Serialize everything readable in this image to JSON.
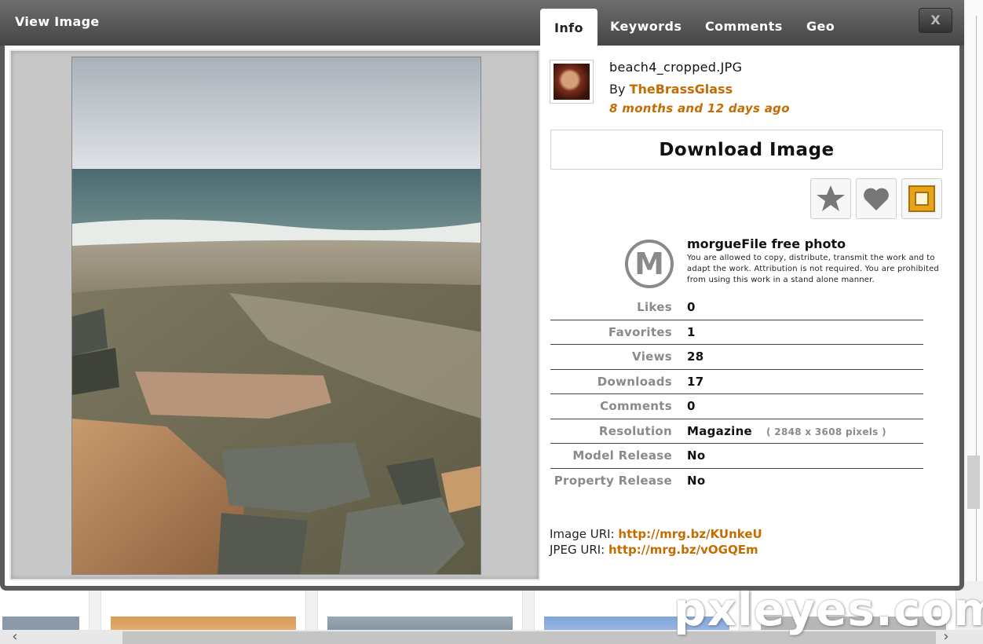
{
  "modal": {
    "title": "View Image",
    "tabs": [
      "Info",
      "Keywords",
      "Comments",
      "Geo"
    ],
    "close_label": "X"
  },
  "image": {
    "file_name": "beach4_cropped.JPG",
    "by_prefix": "By",
    "author": "TheBrassGlass",
    "age": "8 months and 12 days ago"
  },
  "download_label": "Download Image",
  "actions": [
    {
      "icon": "star-icon",
      "color": "#777777"
    },
    {
      "icon": "heart-icon",
      "color": "#777777"
    },
    {
      "icon": "frame-icon",
      "color": "#e8a31c"
    }
  ],
  "license": {
    "logo_letter": "M",
    "title": "morgueFile free photo",
    "text": "You are allowed to copy, distribute, transmit the work and to adapt the work. Attribution is not required. You are prohibited from using this work in a stand alone manner."
  },
  "stats": [
    {
      "label": "Likes",
      "value": "0"
    },
    {
      "label": "Favorites",
      "value": "1"
    },
    {
      "label": "Views",
      "value": "28"
    },
    {
      "label": "Downloads",
      "value": "17"
    },
    {
      "label": "Comments",
      "value": "0"
    },
    {
      "label": "Resolution",
      "value": "Magazine",
      "extra": "( 2848 x 3608 pixels )"
    },
    {
      "label": "Model Release",
      "value": "No"
    },
    {
      "label": "Property Release",
      "value": "No"
    }
  ],
  "uris": [
    {
      "label": "Image URI:",
      "link": "http://mrg.bz/KUnkeU"
    },
    {
      "label": "JPEG URI:",
      "link": "http://mrg.bz/vOGQEm"
    }
  ],
  "gallery": {
    "prev_label": "‹",
    "next_label": "›"
  },
  "watermark": "pxleyes.com",
  "colors": {
    "accent": "#c56c00",
    "header": "#4f4f4f"
  }
}
